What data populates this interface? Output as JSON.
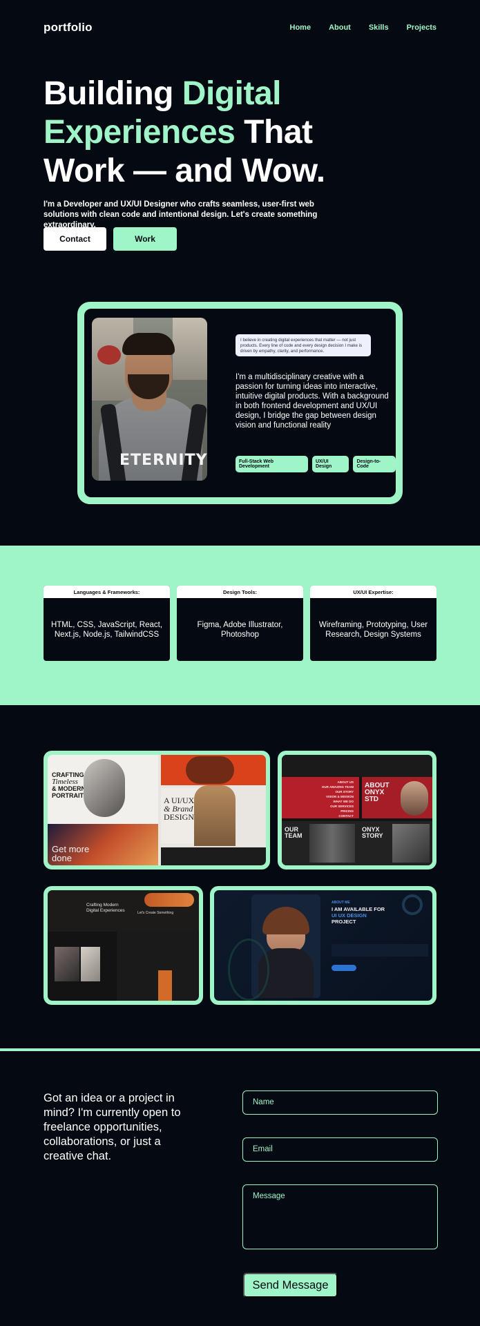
{
  "nav": {
    "logo": "portfolio",
    "links": [
      "Home",
      "About",
      "Skills",
      "Projects"
    ]
  },
  "hero": {
    "title_part1": "Building ",
    "title_part2": "Digital",
    "title_part3": "Experiences",
    "title_part4": " That",
    "title_part5": "Work — and Wow.",
    "subtitle": "I'm a Developer and UX/UI Designer who crafts seamless, user-first web solutions with clean code and intentional design. Let's create something extraordinary.",
    "contact_label": "Contact",
    "work_label": "Work"
  },
  "about": {
    "quote": "I believe in creating digital experiences that matter — not just products. Every line of code and every design decision I make is driven by empathy, clarity, and performance.",
    "text": "I'm a multidisciplinary creative with a passion for turning ideas into interactive, intuitive digital products. With a background in both frontend development and UX/UI design, I bridge the gap between design vision and functional reality",
    "tags": [
      "Full-Stack Web Development",
      "UX/UI Design",
      "Design-to-Code"
    ],
    "photo_text": "ETERNITY"
  },
  "skills": [
    {
      "heading": "Languages & Frameworks:",
      "body": "HTML, CSS, JavaScript, React, Next.js, Node.js, TailwindCSS"
    },
    {
      "heading": "Design Tools:",
      "body": "Figma, Adobe Illustrator, Photoshop"
    },
    {
      "heading": "UX/UI Expertise:",
      "body": "Wireframing, Prototyping, User Research, Design Systems"
    }
  ],
  "projects": {
    "p1": {
      "t1": "CRAFTING",
      "t2": "Timeless",
      "t3": "& MODERN",
      "t4": "PORTRAITS",
      "t5": "A UI/UX",
      "t6": "& Brand",
      "t7": "DESIGNER",
      "t8": "Get more",
      "t9": "done"
    },
    "p2": {
      "t1": "ABOUT",
      "t2": "ONYX",
      "t3": "STD",
      "t4": "OUR",
      "t5": "TEAM",
      "t6": "ONYX",
      "t7": "STORY",
      "menu": [
        "ABOUT US",
        "OUR AMAZING TEAM",
        "OUR STORY",
        "VISION & MISSION",
        "WHAT WE DO",
        "OUR SERVICES",
        "PRICING",
        "CONTACT"
      ]
    },
    "p3": {
      "t1": "Crafting Modern",
      "t2": "Digital Experiences",
      "t3": "Let's Create Something"
    },
    "p4": {
      "t1": "ABOUT ME",
      "t2": "I AM AVAILABLE FOR",
      "t3": "UI UX DESIGN",
      "t4": "PROJECT"
    }
  },
  "contact": {
    "text": "Got an idea or a project in mind? I'm currently open to freelance opportunities, collaborations, or just a creative chat.",
    "name_placeholder": "Name",
    "email_placeholder": "Email",
    "message_placeholder": "Message",
    "send_label": "Send Message"
  },
  "colors": {
    "accent": "#9ff5c8",
    "background": "#050a12"
  }
}
